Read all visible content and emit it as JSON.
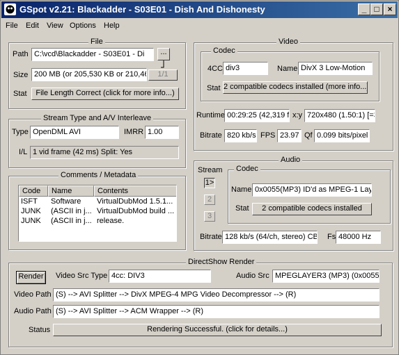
{
  "window": {
    "title": "GSpot v2.21: Blackadder - S03E01 - Dish And Dishonesty"
  },
  "menu": [
    "File",
    "Edit",
    "View",
    "Options",
    "Help"
  ],
  "file": {
    "group_label": "File",
    "path_label": "Path",
    "path_value": "C:\\vcd\\Blackadder - S03E01 - Di",
    "browse_label": "...",
    "size_label": "Size",
    "size_value": "200 MB (or 205,530 KB or 210,46",
    "page_label": "1/1",
    "stat_label": "Stat",
    "stat_button": "File Length Correct (click for more info...)"
  },
  "stream": {
    "group_label": "Stream Type and A/V Interleave",
    "type_label": "Type",
    "type_value": "OpenDML AVI",
    "imrr_label": "IMRR",
    "imrr_value": "1.00",
    "il_label": "I/L",
    "il_value": "1 vid frame (42 ms)  Split: Yes"
  },
  "comments": {
    "group_label": "Comments / Metadata",
    "columns": [
      "Code",
      "Name",
      "Contents"
    ],
    "rows": [
      {
        "code": "ISFT",
        "name": "Software",
        "contents": "VirtualDubMod 1.5.1..."
      },
      {
        "code": "JUNK",
        "name": "(ASCII in j...",
        "contents": "VirtualDubMod build ..."
      },
      {
        "code": "JUNK",
        "name": "(ASCII in j...",
        "contents": "release."
      }
    ]
  },
  "video": {
    "group_label": "Video",
    "codec_label": "Codec",
    "fourcc_label": "4CC",
    "fourcc_value": "div3",
    "name_label": "Name",
    "name_value": "DivX 3 Low-Motion",
    "stat_label": "Stat",
    "stat_button": "2 compatible codecs installed (more info...)",
    "runtime_label": "Runtime",
    "runtime_value": "00:29:25 (42,319 fr",
    "xy_label": "x:y",
    "xy_value": "720x480 (1.50:1) [=3:",
    "bitrate_label": "Bitrate",
    "bitrate_value": "820 kb/s",
    "fps_label": "FPS",
    "fps_value": "23.97",
    "qf_label": "Qf",
    "qf_value": "0.099 bits/pixel"
  },
  "audio": {
    "group_label": "Audio",
    "stream_label": "Stream",
    "stream_buttons": [
      "1>",
      "2",
      "3"
    ],
    "codec_label": "Codec",
    "name_label": "Name",
    "name_value": "0x0055(MP3) ID'd as MPEG-1 Lay",
    "stat_label": "Stat",
    "stat_button": "2 compatible codecs installed",
    "bitrate_label": "Bitrate",
    "bitrate_value": "128 kb/s (64/ch, stereo) CB",
    "fs_label": "Fs",
    "fs_value": "48000 Hz"
  },
  "directshow": {
    "group_label": "DirectShow Render",
    "render_button": "Render",
    "vsrc_label": "Video Src Type",
    "vsrc_value": "4cc: DIV3",
    "asrc_label": "Audio Src",
    "asrc_value": "MPEGLAYER3 (MP3) (0x0055)",
    "vpath_label": "Video Path",
    "vpath_value": "(S) --> AVI Splitter --> DivX MPEG-4 MPG Video Decompressor  --> (R)",
    "apath_label": "Audio Path",
    "apath_value": "(S) --> AVI Splitter --> ACM Wrapper --> (R)",
    "status_label": "Status",
    "status_button": "Rendering Successful.  (click for details...)"
  }
}
